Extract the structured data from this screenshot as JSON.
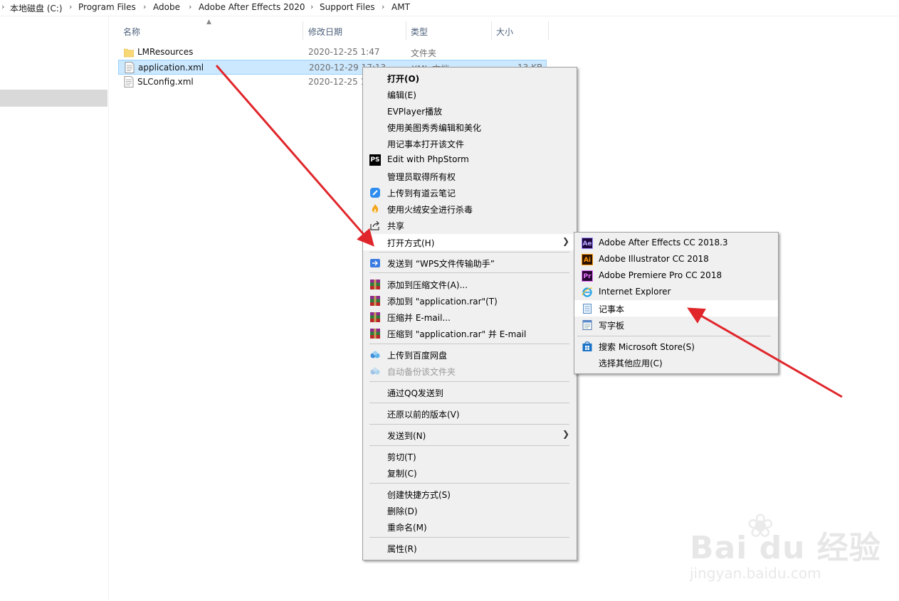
{
  "breadcrumb": [
    "本地磁盘 (C:)",
    "Program Files",
    "Adobe",
    "Adobe After Effects 2020",
    "Support Files",
    "AMT"
  ],
  "columns": {
    "name": "名称",
    "date": "修改日期",
    "type": "类型",
    "size": "大小"
  },
  "files": [
    {
      "name": "LMResources",
      "date": "2020-12-25 1:47",
      "type": "文件夹",
      "size": "",
      "icon": "folder-icon"
    },
    {
      "name": "application.xml",
      "date": "2020-12-29 17:13",
      "type": "XML 文档",
      "size": "13 KB",
      "icon": "xml-file-icon"
    },
    {
      "name": "SLConfig.xml",
      "date": "2020-12-25 1",
      "type": "",
      "size": "",
      "icon": "xml-file-icon"
    }
  ],
  "context_menu": {
    "open": "打开(O)",
    "edit": "编辑(E)",
    "evplayer": "EVPlayer播放",
    "meitu": "使用美图秀秀编辑和美化",
    "notepad_open": "用记事本打开该文件",
    "phpstorm": "Edit with PhpStorm",
    "take_ownership": "管理员取得所有权",
    "youdao": "上传到有道云笔记",
    "huorong": "使用火绒安全进行杀毒",
    "share": "共享",
    "open_with": "打开方式(H)",
    "wps_send": "发送到 “WPS文件传输助手”",
    "add_archive": "添加到压缩文件(A)...",
    "add_rar": "添加到 \"application.rar\"(T)",
    "compress_email": "压缩并 E-mail...",
    "compress_rar_email": "压缩到 \"application.rar\" 并 E-mail",
    "baidu_upload": "上传到百度网盘",
    "auto_backup": "自动备份该文件夹",
    "qq_send": "通过QQ发送到",
    "restore": "还原以前的版本(V)",
    "send_to": "发送到(N)",
    "cut": "剪切(T)",
    "copy": "复制(C)",
    "shortcut": "创建快捷方式(S)",
    "delete": "删除(D)",
    "rename": "重命名(M)",
    "properties": "属性(R)"
  },
  "open_with_menu": {
    "ae": "Adobe After Effects CC 2018.3",
    "ai": "Adobe Illustrator CC 2018",
    "pr": "Adobe Premiere Pro CC 2018",
    "ie": "Internet Explorer",
    "notepad": "记事本",
    "wordpad": "写字板",
    "store": "搜索 Microsoft Store(S)",
    "other": "选择其他应用(C)"
  },
  "icons": {
    "ae": "Ae",
    "ai": "Ai",
    "pr": "Pr",
    "ps": "PS"
  },
  "colors": {
    "selection": "#cce8ff",
    "arrow": "#e0262b",
    "menu_bg": "#f0f0f0"
  },
  "watermark": {
    "brand": "Bai du 经验",
    "sub": "jingyan.baidu.com"
  }
}
